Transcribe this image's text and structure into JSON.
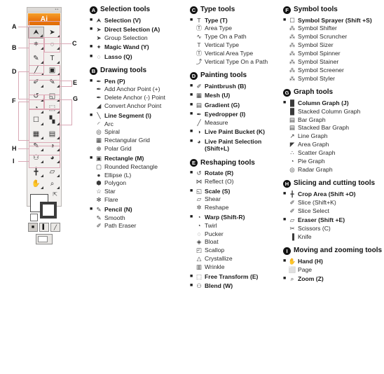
{
  "figure": {
    "app_logo": "Ai",
    "name": "illustrator-toolbox",
    "callouts": [
      "A",
      "B",
      "C",
      "D",
      "E",
      "F",
      "G",
      "H",
      "I"
    ],
    "tool_icons": [
      [
        "selection-icon",
        "direct-selection-icon"
      ],
      [
        "magic-wand-icon",
        "lasso-icon"
      ],
      [
        "pen-icon",
        "type-icon"
      ],
      [
        "line-segment-icon",
        "rectangle-icon"
      ],
      [
        "paintbrush-icon",
        "pencil-icon"
      ],
      [
        "rotate-icon",
        "scale-icon"
      ],
      [
        "warp-icon",
        "free-transform-icon"
      ],
      [
        "symbol-sprayer-icon",
        "column-graph-icon"
      ],
      [
        "mesh-icon",
        "gradient-icon"
      ],
      [
        "eyedropper-icon",
        "live-paint-bucket-icon"
      ],
      [
        "blend-icon",
        "live-paint-selection-icon"
      ],
      [
        "crop-area-icon",
        "eraser-icon"
      ],
      [
        "hand-icon",
        "zoom-icon"
      ]
    ],
    "swatches": {
      "fill": "#ffffff",
      "stroke": "#3b3b3b",
      "swap_icon": "swap-fill-stroke-icon",
      "default_icon": "default-fill-stroke-icon",
      "modes": [
        "color-mode-icon",
        "gradient-mode-icon",
        "none-mode-icon"
      ],
      "screen_mode": "screen-mode-icon"
    }
  },
  "groups": [
    {
      "letter": "A",
      "title": "Selection tools",
      "column": 1,
      "items": [
        {
          "primary": true,
          "icon": "selection-icon",
          "label": "Selection (V)"
        },
        {
          "primary": true,
          "icon": "direct-selection-icon",
          "label": "Direct Selection (A)"
        },
        {
          "primary": false,
          "icon": "group-selection-icon",
          "label": "Group Selection"
        },
        {
          "primary": true,
          "icon": "magic-wand-icon",
          "label": "Magic Wand (Y)"
        },
        {
          "primary": true,
          "icon": "lasso-icon",
          "label": "Lasso (Q)"
        }
      ]
    },
    {
      "letter": "B",
      "title": "Drawing tools",
      "column": 1,
      "items": [
        {
          "primary": true,
          "icon": "pen-icon",
          "label": "Pen (P)"
        },
        {
          "primary": false,
          "icon": "add-anchor-point-icon",
          "label": "Add Anchor Point (+)"
        },
        {
          "primary": false,
          "icon": "delete-anchor-point-icon",
          "label": "Delete Anchor (-) Point"
        },
        {
          "primary": false,
          "icon": "convert-anchor-point-icon",
          "label": "Convert Anchor Point"
        },
        {
          "primary": true,
          "icon": "line-segment-icon",
          "label": "Line Segment (\\)"
        },
        {
          "primary": false,
          "icon": "arc-icon",
          "label": "Arc"
        },
        {
          "primary": false,
          "icon": "spiral-icon",
          "label": "Spiral"
        },
        {
          "primary": false,
          "icon": "rectangular-grid-icon",
          "label": "Rectangular Grid"
        },
        {
          "primary": false,
          "icon": "polar-grid-icon",
          "label": "Polar Grid"
        },
        {
          "primary": true,
          "icon": "rectangle-icon",
          "label": "Rectangle (M)"
        },
        {
          "primary": false,
          "icon": "rounded-rectangle-icon",
          "label": "Rounded Rectangle"
        },
        {
          "primary": false,
          "icon": "ellipse-icon",
          "label": "Ellipse (L)"
        },
        {
          "primary": false,
          "icon": "polygon-icon",
          "label": "Polygon"
        },
        {
          "primary": false,
          "icon": "star-icon",
          "label": "Star"
        },
        {
          "primary": false,
          "icon": "flare-icon",
          "label": "Flare"
        },
        {
          "primary": true,
          "icon": "pencil-icon",
          "label": "Pencil (N)"
        },
        {
          "primary": false,
          "icon": "smooth-icon",
          "label": "Smooth"
        },
        {
          "primary": false,
          "icon": "path-eraser-icon",
          "label": "Path Eraser"
        }
      ]
    },
    {
      "letter": "C",
      "title": "Type tools",
      "column": 2,
      "items": [
        {
          "primary": true,
          "icon": "type-icon",
          "label": "Type (T)"
        },
        {
          "primary": false,
          "icon": "area-type-icon",
          "label": "Area Type"
        },
        {
          "primary": false,
          "icon": "type-on-a-path-icon",
          "label": "Type On a Path"
        },
        {
          "primary": false,
          "icon": "vertical-type-icon",
          "label": "Vertical Type"
        },
        {
          "primary": false,
          "icon": "vertical-area-type-icon",
          "label": "Vertical Area Type"
        },
        {
          "primary": false,
          "icon": "vertical-type-on-path-icon",
          "label": "Vertical Type On a Path"
        }
      ]
    },
    {
      "letter": "D",
      "title": "Painting tools",
      "column": 2,
      "items": [
        {
          "primary": true,
          "icon": "paintbrush-icon",
          "label": "Paintbrush (B)"
        },
        {
          "primary": true,
          "icon": "mesh-icon",
          "label": "Mesh (U)"
        },
        {
          "primary": true,
          "icon": "gradient-icon",
          "label": "Gradient (G)"
        },
        {
          "primary": true,
          "icon": "eyedropper-icon",
          "label": "Eyedropper (I)"
        },
        {
          "primary": false,
          "icon": "measure-icon",
          "label": "Measure"
        },
        {
          "primary": true,
          "icon": "live-paint-bucket-icon",
          "label": "Live Paint Bucket (K)"
        },
        {
          "primary": true,
          "icon": "live-paint-selection-icon",
          "label": "Live Paint Selection (Shift+L)"
        }
      ]
    },
    {
      "letter": "E",
      "title": "Reshaping tools",
      "column": 2,
      "items": [
        {
          "primary": true,
          "icon": "rotate-icon",
          "label": "Rotate (R)"
        },
        {
          "primary": false,
          "icon": "reflect-icon",
          "label": "Reflect (O)"
        },
        {
          "primary": true,
          "icon": "scale-icon",
          "label": "Scale (S)"
        },
        {
          "primary": false,
          "icon": "shear-icon",
          "label": "Shear"
        },
        {
          "primary": false,
          "icon": "reshape-icon",
          "label": "Reshape"
        },
        {
          "primary": true,
          "icon": "warp-icon",
          "label": "Warp (Shift-R)"
        },
        {
          "primary": false,
          "icon": "twirl-icon",
          "label": "Twirl"
        },
        {
          "primary": false,
          "icon": "pucker-icon",
          "label": "Pucker"
        },
        {
          "primary": false,
          "icon": "bloat-icon",
          "label": "Bloat"
        },
        {
          "primary": false,
          "icon": "scallop-icon",
          "label": "Scallop"
        },
        {
          "primary": false,
          "icon": "crystallize-icon",
          "label": "Crystallize"
        },
        {
          "primary": false,
          "icon": "wrinkle-icon",
          "label": "Wrinkle"
        },
        {
          "primary": true,
          "icon": "free-transform-icon",
          "label": "Free Transform (E)"
        },
        {
          "primary": true,
          "icon": "blend-icon",
          "label": "Blend (W)"
        }
      ]
    },
    {
      "letter": "F",
      "title": "Symbol tools",
      "column": 3,
      "items": [
        {
          "primary": true,
          "icon": "symbol-sprayer-icon",
          "label": "Symbol Sprayer (Shift +S)"
        },
        {
          "primary": false,
          "icon": "symbol-shifter-icon",
          "label": "Symbol Shifter"
        },
        {
          "primary": false,
          "icon": "symbol-scruncher-icon",
          "label": "Symbol Scruncher"
        },
        {
          "primary": false,
          "icon": "symbol-sizer-icon",
          "label": "Symbol Sizer"
        },
        {
          "primary": false,
          "icon": "symbol-spinner-icon",
          "label": "Symbol Spinner"
        },
        {
          "primary": false,
          "icon": "symbol-stainer-icon",
          "label": "Symbol Stainer"
        },
        {
          "primary": false,
          "icon": "symbol-screener-icon",
          "label": "Symbol Screener"
        },
        {
          "primary": false,
          "icon": "symbol-styler-icon",
          "label": "Symbol Styler"
        }
      ]
    },
    {
      "letter": "G",
      "title": "Graph tools",
      "column": 3,
      "items": [
        {
          "primary": true,
          "icon": "column-graph-icon",
          "label": "Column Graph (J)"
        },
        {
          "primary": false,
          "icon": "stacked-column-graph-icon",
          "label": "Stacked Column Graph"
        },
        {
          "primary": false,
          "icon": "bar-graph-icon",
          "label": "Bar Graph"
        },
        {
          "primary": false,
          "icon": "stacked-bar-graph-icon",
          "label": "Stacked Bar Graph"
        },
        {
          "primary": false,
          "icon": "line-graph-icon",
          "label": "Line Graph"
        },
        {
          "primary": false,
          "icon": "area-graph-icon",
          "label": "Area Graph"
        },
        {
          "primary": false,
          "icon": "scatter-graph-icon",
          "label": "Scatter Graph"
        },
        {
          "primary": false,
          "icon": "pie-graph-icon",
          "label": "Pie Graph"
        },
        {
          "primary": false,
          "icon": "radar-graph-icon",
          "label": "Radar Graph"
        }
      ]
    },
    {
      "letter": "H",
      "title": "Slicing and cutting tools",
      "column": 3,
      "items": [
        {
          "primary": true,
          "icon": "crop-area-icon",
          "label": "Crop Area (Shift +O)"
        },
        {
          "primary": false,
          "icon": "slice-icon",
          "label": "Slice (Shift+K)"
        },
        {
          "primary": false,
          "icon": "slice-select-icon",
          "label": "Slice Select"
        },
        {
          "primary": true,
          "icon": "eraser-icon",
          "label": "Eraser (Shift +E)"
        },
        {
          "primary": false,
          "icon": "scissors-icon",
          "label": "Scissors (C)"
        },
        {
          "primary": false,
          "icon": "knife-icon",
          "label": "Knife"
        }
      ]
    },
    {
      "letter": "I",
      "title": "Moving and zooming tools",
      "column": 3,
      "items": [
        {
          "primary": true,
          "icon": "hand-icon",
          "label": "Hand (H)"
        },
        {
          "primary": false,
          "icon": "page-icon",
          "label": "Page"
        },
        {
          "primary": true,
          "icon": "zoom-icon",
          "label": "Zoom (Z)"
        }
      ]
    }
  ],
  "icon_glyphs": {
    "selection-icon": "⮝",
    "direct-selection-icon": "➤",
    "group-selection-icon": "➤",
    "magic-wand-icon": "✦",
    "lasso-icon": "◌",
    "pen-icon": "✒",
    "add-anchor-point-icon": "✒",
    "delete-anchor-point-icon": "✒",
    "convert-anchor-point-icon": "◢",
    "line-segment-icon": "╲",
    "arc-icon": "◜",
    "spiral-icon": "◎",
    "rectangular-grid-icon": "▦",
    "polar-grid-icon": "⊕",
    "rectangle-icon": "▣",
    "rounded-rectangle-icon": "▢",
    "ellipse-icon": "●",
    "polygon-icon": "⬢",
    "star-icon": "☆",
    "flare-icon": "✻",
    "pencil-icon": "✎",
    "smooth-icon": "✎",
    "path-eraser-icon": "✐",
    "type-icon": "T",
    "area-type-icon": "Ⓣ",
    "type-on-a-path-icon": "∿",
    "vertical-type-icon": "T",
    "vertical-area-type-icon": "Ⓣ",
    "vertical-type-on-path-icon": "⤴",
    "paintbrush-icon": "✐",
    "mesh-icon": "▦",
    "gradient-icon": "▤",
    "eyedropper-icon": "✒",
    "measure-icon": "╱",
    "live-paint-bucket-icon": "◑",
    "live-paint-selection-icon": "◕",
    "rotate-icon": "↺",
    "reflect-icon": "⋈",
    "scale-icon": "◱",
    "shear-icon": "▱",
    "reshape-icon": "✲",
    "warp-icon": "◔",
    "twirl-icon": "◔",
    "pucker-icon": "◌",
    "bloat-icon": "◈",
    "scallop-icon": "◰",
    "crystallize-icon": "△",
    "wrinkle-icon": "▥",
    "free-transform-icon": "⬚",
    "blend-icon": "⚇",
    "symbol-sprayer-icon": "☐",
    "symbol-shifter-icon": "⁂",
    "symbol-scruncher-icon": "⁂",
    "symbol-sizer-icon": "⁂",
    "symbol-spinner-icon": "⁂",
    "symbol-stainer-icon": "⁂",
    "symbol-screener-icon": "⁂",
    "symbol-styler-icon": "⁂",
    "column-graph-icon": "█",
    "stacked-column-graph-icon": "█",
    "bar-graph-icon": "▤",
    "stacked-bar-graph-icon": "▤",
    "line-graph-icon": "↗",
    "area-graph-icon": "◤",
    "scatter-graph-icon": "∴",
    "pie-graph-icon": "◔",
    "radar-graph-icon": "◎",
    "crop-area-icon": "╋",
    "slice-icon": "✐",
    "slice-select-icon": "✐",
    "eraser-icon": "▱",
    "scissors-icon": "✂",
    "knife-icon": "▐",
    "hand-icon": "✋",
    "page-icon": "⬜",
    "zoom-icon": "⌕"
  }
}
